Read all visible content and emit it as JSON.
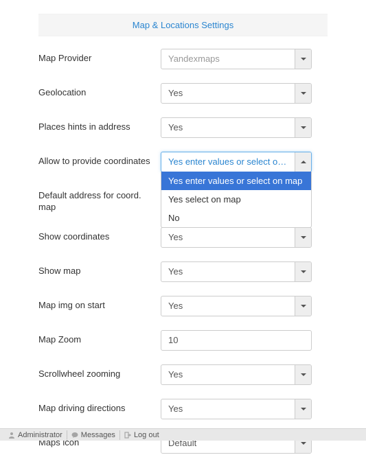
{
  "section_title": "Map & Locations Settings",
  "rows": {
    "map_provider": {
      "label": "Map Provider",
      "value": "Yandexmaps"
    },
    "geolocation": {
      "label": "Geolocation",
      "value": "Yes"
    },
    "places_hints": {
      "label": "Places hints in address",
      "value": "Yes"
    },
    "allow_coords": {
      "label": "Allow to provide coordinates",
      "value": "Yes enter values or select on …",
      "options": [
        "Yes enter values or select on map",
        "Yes select on map",
        "No"
      ]
    },
    "default_address": {
      "label": "Default address for coord. map",
      "value": ""
    },
    "show_coords": {
      "label": "Show coordinates",
      "value": "Yes"
    },
    "show_map": {
      "label": "Show map",
      "value": "Yes"
    },
    "map_img_start": {
      "label": "Map img on start",
      "value": "Yes"
    },
    "map_zoom": {
      "label": "Map Zoom",
      "value": "10"
    },
    "scrollwheel": {
      "label": "Scrollwheel zooming",
      "value": "Yes"
    },
    "driving": {
      "label": "Map driving directions",
      "value": "Yes"
    },
    "maps_icon": {
      "label": "Maps icon",
      "value": "Default"
    }
  },
  "footer": {
    "administrator": "Administrator",
    "messages": "Messages",
    "logout": "Log out"
  }
}
